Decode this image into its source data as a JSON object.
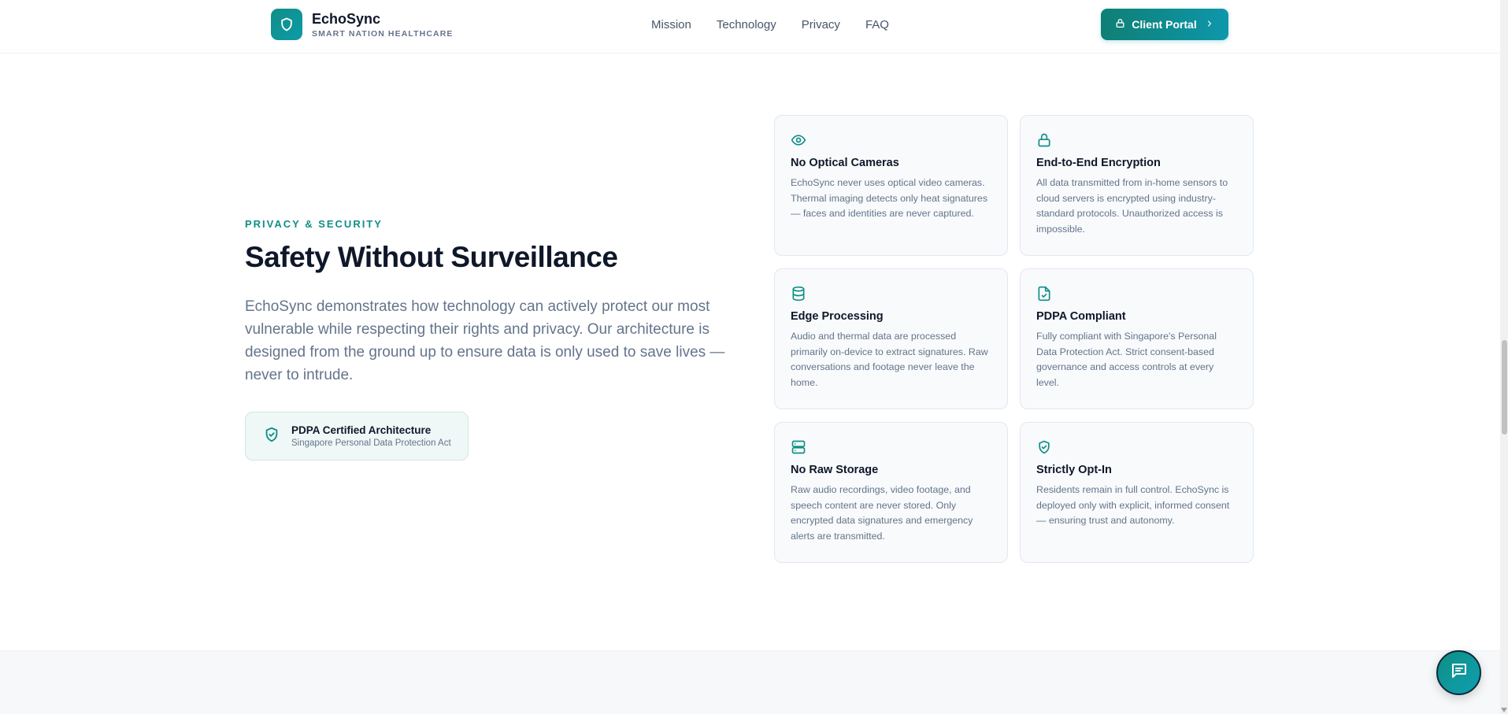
{
  "header": {
    "brand_name": "EchoSync",
    "brand_tagline": "SMART NATION HEALTHCARE",
    "nav": [
      {
        "label": "Mission"
      },
      {
        "label": "Technology"
      },
      {
        "label": "Privacy"
      },
      {
        "label": "FAQ"
      }
    ],
    "portal_button": "Client Portal"
  },
  "section": {
    "eyebrow": "PRIVACY & SECURITY",
    "title": "Safety Without Surveillance",
    "lead": "EchoSync demonstrates how technology can actively protect our most vulnerable while respecting their rights and privacy. Our architecture is designed from the ground up to ensure data is only used to save lives — never to intrude.",
    "badge": {
      "title": "PDPA Certified Architecture",
      "subtitle": "Singapore Personal Data Protection Act"
    }
  },
  "cards": [
    {
      "icon": "eye-icon",
      "title": "No Optical Cameras",
      "body": "EchoSync never uses optical video cameras. Thermal imaging detects only heat signatures — faces and identities are never captured."
    },
    {
      "icon": "lock-icon",
      "title": "End-to-End Encryption",
      "body": "All data transmitted from in-home sensors to cloud servers is encrypted using industry-standard protocols. Unauthorized access is impossible."
    },
    {
      "icon": "database-icon",
      "title": "Edge Processing",
      "body": "Audio and thermal data are processed primarily on-device to extract signatures. Raw conversations and footage never leave the home."
    },
    {
      "icon": "file-check-icon",
      "title": "PDPA Compliant",
      "body": "Fully compliant with Singapore's Personal Data Protection Act. Strict consent-based governance and access controls at every level."
    },
    {
      "icon": "server-icon",
      "title": "No Raw Storage",
      "body": "Raw audio recordings, video footage, and speech content are never stored. Only encrypted data signatures and emergency alerts are transmitted."
    },
    {
      "icon": "shield-check-icon",
      "title": "Strictly Opt-In",
      "body": "Residents remain in full control. EchoSync is deployed only with explicit, informed consent — ensuring trust and autonomy."
    }
  ],
  "colors": {
    "accent": "#0f8f86",
    "text_dark": "#0f172a",
    "text_muted": "#64748b"
  }
}
